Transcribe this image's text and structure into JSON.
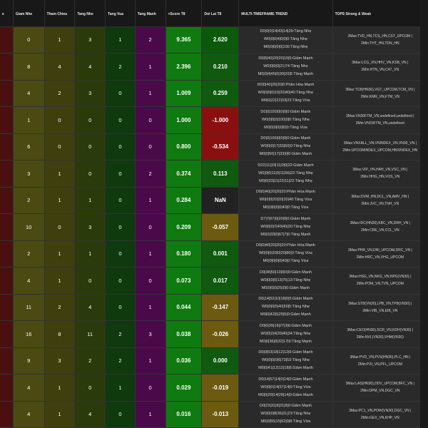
{
  "headers": [
    "e",
    "Giam Nhe",
    "Tham Chieu",
    "Tang Nhe",
    "Tang Vua",
    "Tang Manh",
    "+Score T8",
    "Doi Lai T8",
    "MULTI-TIMEFRAME TREND",
    "TOPS Strong & Weak"
  ],
  "colors": {
    "lai_green": "#0b5a0b",
    "lai_dark_green": "#0f5a0f",
    "lai_red": "#8a1010",
    "lai_olive": "#6b5a10",
    "lai_dark": "#222222"
  },
  "rows": [
    {
      "c": [
        "",
        "0",
        "1",
        "3",
        "1",
        "2"
      ],
      "score": "9.365",
      "lai": "2.620",
      "lai_color": "#0b5a0b",
      "trend": [
        "D0|0|0|14|43|14|29:Tăng Nhẹ",
        "W0|0|0|4|0|0|0:Tăng Nhẹ",
        "M0|0|0|0|0|100:Tăng Nhẹ"
      ],
      "tops": [
        "3Max:TVD_HN,TCS_HN,CST_UPCOM |",
        "2Min:THT_HN,TDN_HN"
      ]
    },
    {
      "c": [
        "",
        "8",
        "4",
        "4",
        "2",
        "1"
      ],
      "score": "2.396",
      "lai": "0.210",
      "lai_color": "#0f5a0f",
      "trend": [
        "D0|5|40|20|20|10|5:Giảm Mạnh",
        "W0|0|0|0|21|74:Tăng Nhẹ",
        "M0|0|4|45|0|30|20|5:Tăng Mạnh"
      ],
      "tops": [
        "3Max:LCG_VN,HHV_VN,KSB_VN |",
        "2Min:HTN_VN,C47_VN"
      ]
    },
    {
      "c": [
        "",
        "4",
        "2",
        "3",
        "0",
        "1"
      ],
      "score": "1.009",
      "lai": "0.259",
      "lai_color": "#0f5a0f",
      "trend": [
        "D0|0|40|20|30|0:Phân Hóa Mạnh",
        "W0|0|0|0|10|20|40|40:Tăng Nhẹ",
        "M0|0|22|22|33|22:Tăng Vừa"
      ],
      "tops": [
        "3Max:TCB(HN30),VGT_UPCOM,TCM_VN |",
        "2Min:KMR_VN,FTM_VN"
      ]
    },
    {
      "c": [
        "",
        "1",
        "0",
        "0",
        "0",
        "0"
      ],
      "score": "1.000",
      "lai": "-1.000",
      "lai_color": "#8a1010",
      "trend": [
        "D0|0|100|0|0|0|0:Giảm Mạnh",
        "W0|0|0|0|100|0|0:Tăng Nhẹ",
        "M0|0|0|0|0|0|0:Tăng Vừa"
      ],
      "tops": [
        "3Max:VN30FTM_VN,undefined,undefined |",
        "2Min:VN30FTM_VN,undefined"
      ]
    },
    {
      "c": [
        "",
        "6",
        "0",
        "0",
        "0",
        "0"
      ],
      "score": "0.800",
      "lai": "-0.534",
      "lai_color": "#8a1010",
      "trend": [
        "D0|0|100|0|0|0|0:Giảm Mạnh",
        "W0|0|0|17|33|50|0:Tăng Nhẹ",
        "M0|0|50|17|33|0|0:Giảm Mạnh"
      ],
      "tops": [
        "3Max:VNXALL_VN,VNINDEX_VN,VN30_VN |",
        "2Min:UPCOMINDEX_UPCOM,HNXINDEX_HN"
      ]
    },
    {
      "c": [
        "",
        "3",
        "1",
        "0",
        "0",
        "2"
      ],
      "score": "0.374",
      "lai": "0.113",
      "lai_color": "#0f5a0f",
      "trend": [
        "D22|11|33|11|0|0|22:Giảm Mạnh",
        "W0|0|0|11|0|11|56|22:Tăng Nhẹ",
        "M0|0|33|11|22|11|22:Tăng Nhẹ"
      ],
      "tops": [
        "3Max:VIP_VN,HAH_VN,VSC_VN |",
        "2Min:HHG_HN,VOS_VN"
      ]
    },
    {
      "c": [
        "",
        "2",
        "1",
        "1",
        "0",
        "1"
      ],
      "score": "0.284",
      "lai": "NaN",
      "lai_color": "#222222",
      "trend": [
        "D0|0|40|20|20|20:Phân Hóa Mạnh",
        "W0|0|0|20|20|20|40:Tăng Vừa",
        "M0|0|0|0|0|40|0:Tăng Vừa"
      ],
      "tops": [
        "3Max:DVM_HN,DCL_VN,AMV_HN |",
        "2Min:JVC_VN,TNH_VN"
      ]
    },
    {
      "c": [
        "",
        "10",
        "0",
        "3",
        "0",
        "0"
      ],
      "score": "0.209",
      "lai": "-0.057",
      "lai_color": "#6b5a10",
      "trend": [
        "D7|7|67|0|20|0|0:Giảm Mạnh",
        "W0|0|0|7|40|40|30:Tăng Nhẹ",
        "M0|0|33|0|67|7|0:Tăng Mạnh"
      ],
      "tops": [
        "3Max:IDC(HN30),KBC_VN,DRH_VN |",
        "2Min:CRE_VN,CCL_VN"
      ]
    },
    {
      "c": [
        "",
        "2",
        "1",
        "1",
        "0",
        "1"
      ],
      "score": "0.180",
      "lai": "0.001",
      "lai_color": "#0f5a0f",
      "trend": [
        "D0|0|40|20|20|20:Phân Hóa Mạnh",
        "W0|0|0|20|0|20|80|0:Tăng Vừa",
        "M0|0|0|0|0|40|0:Tăng Vừa"
      ],
      "tops": [
        "3Max:PHR_VN,DRI_UPCOM,DRC_VN |",
        "2Min:HRC_VN,VHG_UPCOM"
      ]
    },
    {
      "c": [
        "",
        "4",
        "1",
        "0",
        "0",
        "0"
      ],
      "score": "0.073",
      "lai": "0.017",
      "lai_color": "#0f5a0f",
      "trend": [
        "D0|38|50|13|0|0|0:Giảm Mạnh",
        "W0|0|0|0|13|75|13:Tăng Nhẹ",
        "M0|0|0|0|25|0|0:Giảm Mạnh"
      ],
      "tops": [
        "3Max:HSG_VN,NKG_VN,HPG(VN30) |",
        "2Min:POM_VN,TVN_UPCOM"
      ]
    },
    {
      "c": [
        "",
        "11",
        "2",
        "4",
        "0",
        "1"
      ],
      "score": "0.044",
      "lai": "-0.147",
      "lai_color": "#6b5a10",
      "trend": [
        "D0|14|52|10|18|0|5:Giảm Mạnh",
        "W0|0|0|5|40|50|5:Tăng Nhẹ",
        "M0|0|42|5|29|5|0:Giảm Mạnh"
      ],
      "tops": [
        "3Max:STB(VN30),LPB_VN,TPB(VN30) |",
        "2Min:VIB_VN,EIB_VN"
      ]
    },
    {
      "c": [
        "",
        "16",
        "8",
        "11",
        "2",
        "3"
      ],
      "score": "0.038",
      "lai": "-0.026",
      "lai_color": "#6b5a10",
      "trend": [
        "D0|0|39|18|27|3|6:Giảm Mạnh",
        "W0|0|2|4|20|40|34:Tăng Nhẹ",
        "M0|0|36|0|32|17|6:Tăng Mạnh"
      ],
      "tops": [
        "3Max:CEO(HN30),SCR_VN,KDH(VN30) |",
        "2Min:NVL(VN30),VHM(VN30)"
      ]
    },
    {
      "c": [
        "",
        "9",
        "3",
        "2",
        "2",
        "1"
      ],
      "score": "0.036",
      "lai": "0.000",
      "lai_color": "#0f5a0f",
      "trend": [
        "D0|0|53|18|12|12|6:Giảm Mạnh",
        "W0|0|0|0|6|73|53:Tăng Nhẹ",
        "M0|0|41|12|12|18|6:Giảm Mạnh"
      ],
      "tops": [
        "3Max:PVD_VN,PVS(HN30),PLC_HN |",
        "2Min:PXI_VN,PFL_UPCOM"
      ]
    },
    {
      "c": [
        "",
        "4",
        "1",
        "0",
        "1",
        "0"
      ],
      "score": "0.029",
      "lai": "-0.019",
      "lai_color": "#6b5a10",
      "trend": [
        "D0|14|57|14|0|14|0:Giảm Mạnh",
        "W0|0|0|14|57|14|0:Tăng Vừa",
        "M0|0|29|14|29|14|0:Giảm Mạnh"
      ],
      "tops": [
        "3Max:LAS(HN30),DDV_UPCOM,BFC_VN |",
        "2Min:DPM_VN,DGC_VN"
      ]
    },
    {
      "c": [
        "",
        "4",
        "1",
        "4",
        "0",
        "1"
      ],
      "score": "0.016",
      "lai": "-0.013",
      "lai_color": "#6b5a10",
      "trend": [
        "D0|23|31|8|31|8|0:Giảm Mạnh",
        "W0|0|0|8|36|31|23:Tăng Nhẹ",
        "M0|0|55|15|62|0|8:Tăng Vừa"
      ],
      "tops": [
        "3Max:PC1_VN,POW(VN30),DGC_VN |",
        "2Min:GEX_VN,KHP_VN"
      ]
    }
  ]
}
